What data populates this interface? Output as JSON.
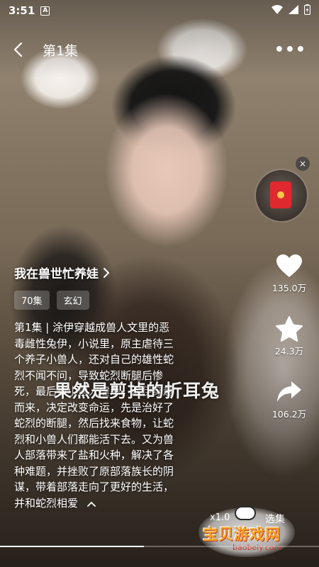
{
  "status_bar": {
    "time": "3:51",
    "badge": "A"
  },
  "header": {
    "episode_title": "第1集"
  },
  "right_rail": {
    "like_count": "135.0万",
    "favorite_count": "24.3万",
    "share_count": "106.2万",
    "close_glyph": "×"
  },
  "drama": {
    "title": "我在兽世忙养娃",
    "tags": [
      "70集",
      "玄幻"
    ],
    "description_lines": [
      "第1集 | 涂伊穿越成兽人文里的恶",
      "毒雌性兔伊，小说里，原主虐待三",
      "个养子小兽人，还对自己的雄性蛇",
      "烈不闻不问，导致蛇烈断腿后惨",
      "死，最后被小兽人虐杀。涂伊穿越",
      "而来，决定改变命运，先是治好了",
      "蛇烈的断腿，然后找来食物，让蛇",
      "烈和小兽人们都能活下去。又为兽",
      "人部落带来了盐和火种，解决了各",
      "种难题，并挫败了原部落族长的阴",
      "谋，带着部落走向了更好的生活，",
      "并和蛇烈相爱"
    ],
    "subtitle": "果然是剪掉的折耳兔"
  },
  "controls": {
    "speed": "x1.0",
    "select_episode": "选集"
  },
  "progress": {
    "fraction": 0.45
  },
  "watermark": {
    "brand": "宝贝游戏网",
    "url": "baobeiy.com"
  },
  "colors": {
    "accent_red": "#e0282f",
    "watermark_orange": "#f5a623"
  }
}
